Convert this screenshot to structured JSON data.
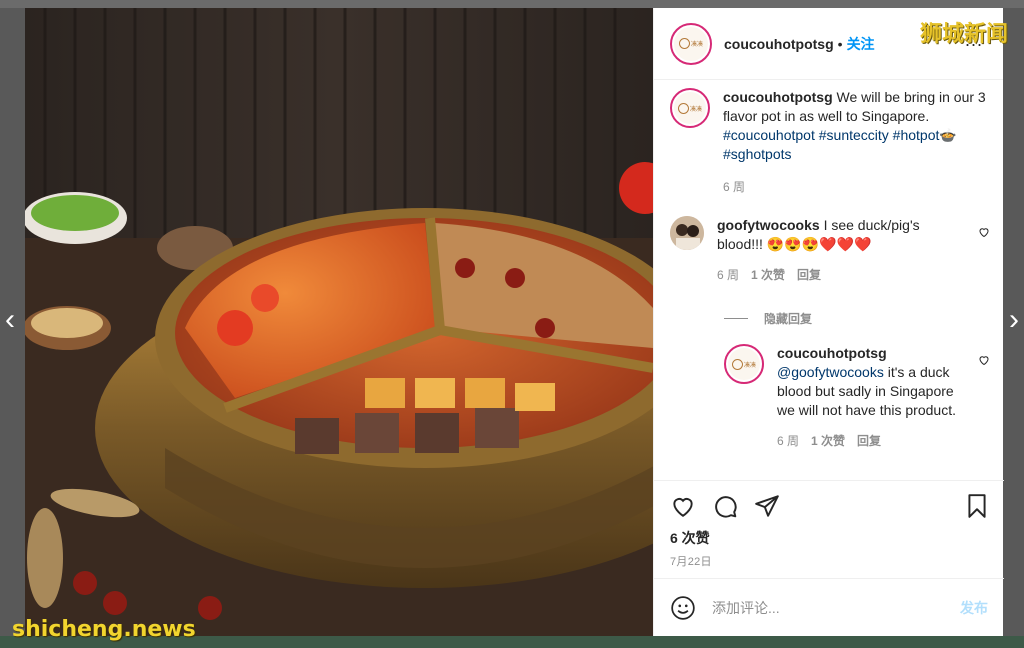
{
  "post": {
    "username": "coucouhotpotsg",
    "follow_label": "关注",
    "more_label": "...",
    "dot": "•",
    "avatar_text": "凑凑"
  },
  "caption": {
    "username": "coucouhotpotsg",
    "text": "We will be bring in our 3 flavor pot in as well to Singapore.",
    "hashtags": "#coucouhotpot #sunteccity #hotpot🍲 #sghotpots",
    "time": "6 周"
  },
  "comments": [
    {
      "username": "goofytwocooks",
      "text": "I see duck/pig's blood!!! 😍😍😍❤️❤️❤️",
      "time": "6 周",
      "likes": "1 次赞",
      "reply_label": "回复"
    }
  ],
  "hide_replies_label": "隐藏回复",
  "reply": {
    "username": "coucouhotpotsg",
    "mention": "@goofytwocooks",
    "text": "it's a duck blood but sadly in Singapore we will not have this product.",
    "time": "6 周",
    "likes": "1 次赞",
    "reply_label": "回复"
  },
  "actions": {
    "like_icon": "heart-icon",
    "comment_icon": "comment-icon",
    "share_icon": "share-icon",
    "save_icon": "bookmark-icon",
    "likes_count": "6 次赞",
    "date": "7月22日"
  },
  "add_comment": {
    "placeholder": "添加评论...",
    "post_label": "发布",
    "emoji_icon": "smiley-icon"
  },
  "navigation": {
    "prev": "‹",
    "next": "›"
  },
  "watermarks": {
    "top": "狮城新闻",
    "bottom": "shicheng.news"
  },
  "colors": {
    "link_blue": "#0095f6",
    "hashtag": "#00376b",
    "muted": "#8e8e8e",
    "heart_red": "#ed4956"
  }
}
